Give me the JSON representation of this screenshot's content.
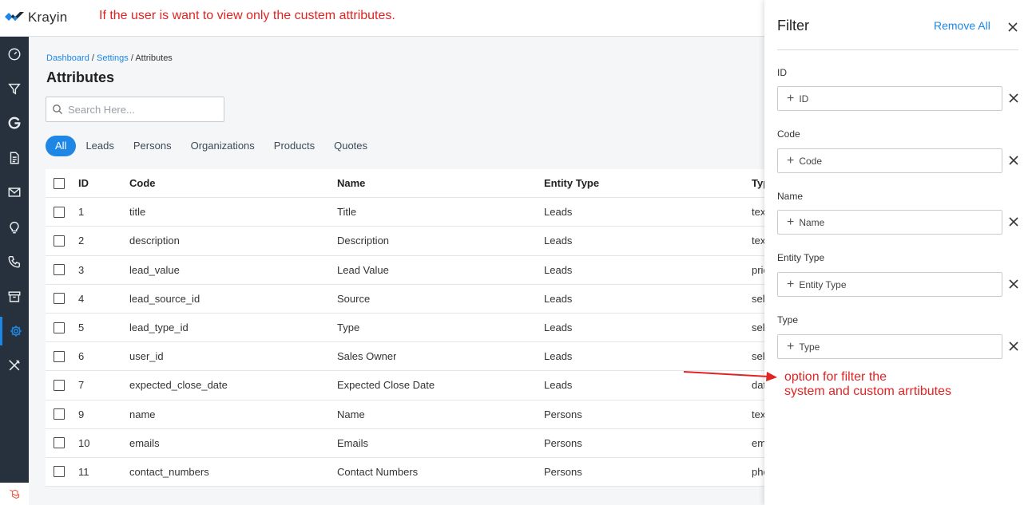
{
  "app": {
    "logo_text": "Krayin"
  },
  "annotations": {
    "top_note": "If the user is want to view only the custem attributes.",
    "side_note_line1": "option for filter the",
    "side_note_line2": "system and custom arrtibutes",
    "color": "#e02424"
  },
  "sidebar": {
    "items": [
      {
        "icon": "dashboard-gauge-icon"
      },
      {
        "icon": "funnel-icon"
      },
      {
        "icon": "google-icon"
      },
      {
        "icon": "document-icon"
      },
      {
        "icon": "mail-icon"
      },
      {
        "icon": "lightbulb-icon"
      },
      {
        "icon": "phone-icon"
      },
      {
        "icon": "archive-box-icon"
      },
      {
        "icon": "settings-gear-icon",
        "active": true
      },
      {
        "icon": "tools-icon"
      }
    ]
  },
  "breadcrumb": {
    "items": [
      "Dashboard",
      "Settings",
      "Attributes"
    ],
    "separator": "/"
  },
  "page": {
    "title": "Attributes"
  },
  "search": {
    "placeholder": "Search Here..."
  },
  "tabs": [
    {
      "label": "All",
      "active": true
    },
    {
      "label": "Leads"
    },
    {
      "label": "Persons"
    },
    {
      "label": "Organizations"
    },
    {
      "label": "Products"
    },
    {
      "label": "Quotes"
    }
  ],
  "table": {
    "headers": {
      "id": "ID",
      "code": "Code",
      "name": "Name",
      "entity_type": "Entity Type",
      "type": "Typ"
    },
    "rows": [
      {
        "id": "1",
        "code": "title",
        "name": "Title",
        "entity_type": "Leads",
        "type": "tex"
      },
      {
        "id": "2",
        "code": "description",
        "name": "Description",
        "entity_type": "Leads",
        "type": "tex"
      },
      {
        "id": "3",
        "code": "lead_value",
        "name": "Lead Value",
        "entity_type": "Leads",
        "type": "pric"
      },
      {
        "id": "4",
        "code": "lead_source_id",
        "name": "Source",
        "entity_type": "Leads",
        "type": "sel"
      },
      {
        "id": "5",
        "code": "lead_type_id",
        "name": "Type",
        "entity_type": "Leads",
        "type": "sel"
      },
      {
        "id": "6",
        "code": "user_id",
        "name": "Sales Owner",
        "entity_type": "Leads",
        "type": "sel"
      },
      {
        "id": "7",
        "code": "expected_close_date",
        "name": "Expected Close Date",
        "entity_type": "Leads",
        "type": "dat"
      },
      {
        "id": "9",
        "code": "name",
        "name": "Name",
        "entity_type": "Persons",
        "type": "tex"
      },
      {
        "id": "10",
        "code": "emails",
        "name": "Emails",
        "entity_type": "Persons",
        "type": "em"
      },
      {
        "id": "11",
        "code": "contact_numbers",
        "name": "Contact Numbers",
        "entity_type": "Persons",
        "type": "pho"
      }
    ]
  },
  "filter_panel": {
    "title": "Filter",
    "remove_all": "Remove All",
    "fields": [
      {
        "label": "ID",
        "button": "ID"
      },
      {
        "label": "Code",
        "button": "Code"
      },
      {
        "label": "Name",
        "button": "Name"
      },
      {
        "label": "Entity Type",
        "button": "Entity Type"
      },
      {
        "label": "Type",
        "button": "Type"
      }
    ]
  },
  "colors": {
    "accent": "#1e87e5",
    "sidebar_bg": "#26313d",
    "annotation": "#e02424"
  }
}
